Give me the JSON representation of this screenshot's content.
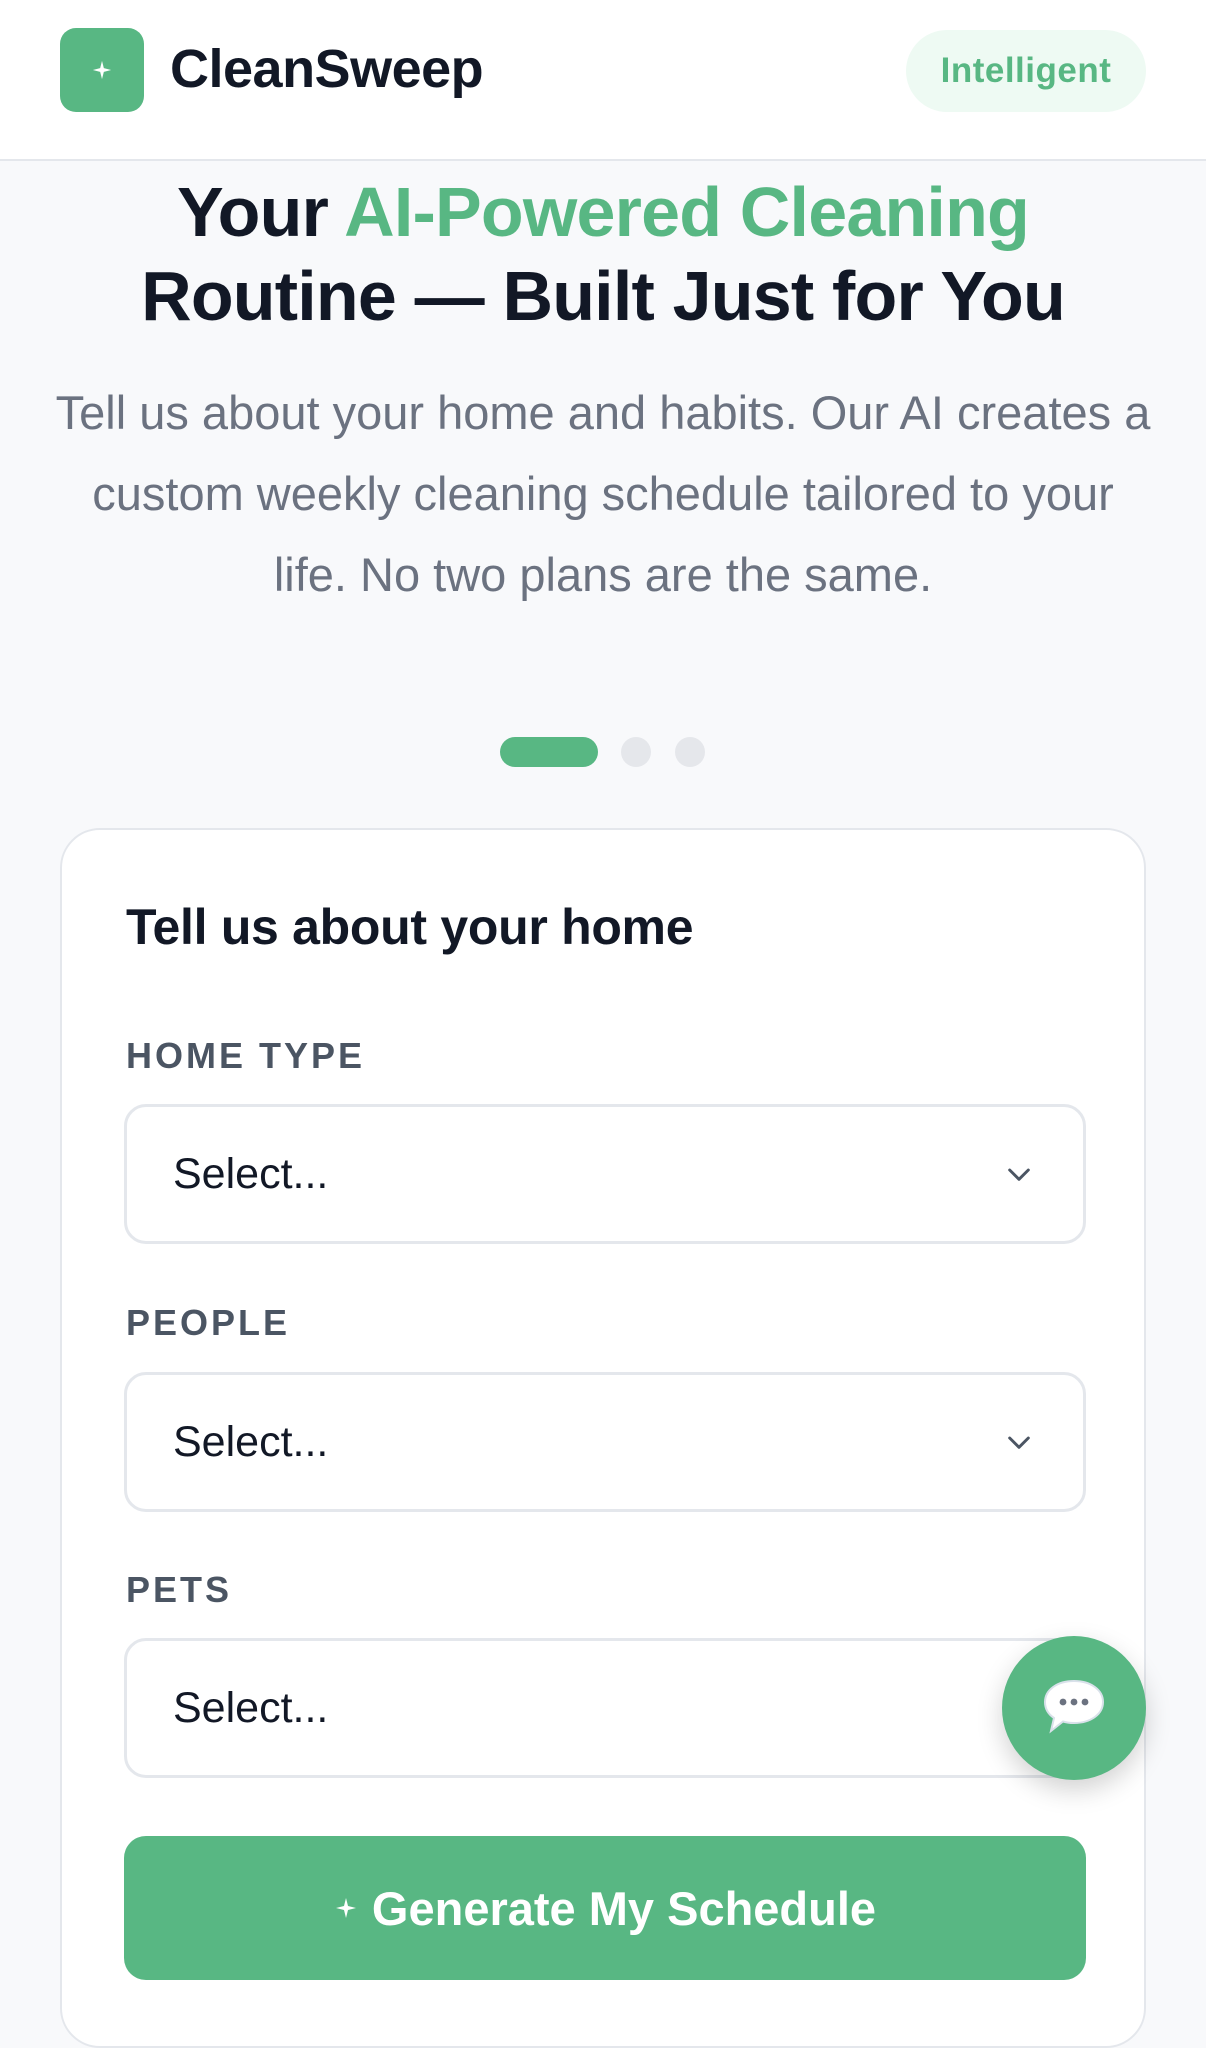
{
  "header": {
    "app_name": "CleanSweep",
    "badge": "Intelligent",
    "logo_icon": "sparkle-icon"
  },
  "hero": {
    "title_part1": "Your ",
    "title_accent": "AI-Powered Cleaning",
    "title_part2": "Routine — Built Just for You",
    "subtitle": "Tell us about your home and habits. Our AI creates a custom weekly cleaning schedule tailored to your life. No two plans are the same."
  },
  "steps": {
    "total": 3,
    "current": 1
  },
  "form": {
    "title": "Tell us about your home",
    "fields": [
      {
        "label": "HOME TYPE",
        "value": "Select..."
      },
      {
        "label": "PEOPLE",
        "value": "Select..."
      },
      {
        "label": "PETS",
        "value": "Select..."
      }
    ],
    "submit_label": "Generate My Schedule"
  },
  "chat": {
    "icon": "chat-bubble-icon"
  },
  "colors": {
    "accent": "#58b783",
    "accent_light": "#eefaf3",
    "text": "#121826",
    "muted": "#6b7280",
    "border": "#e4e7ec"
  }
}
